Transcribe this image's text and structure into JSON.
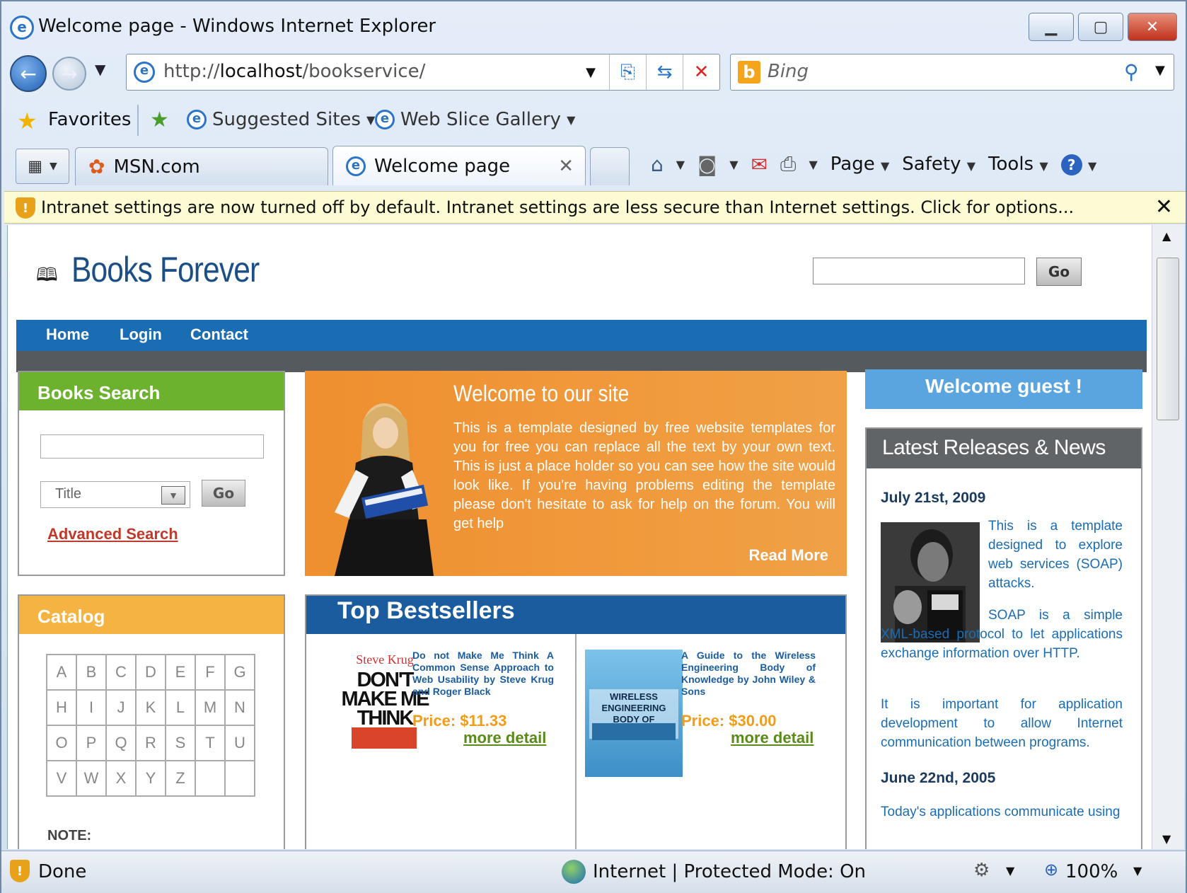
{
  "window": {
    "title": "Welcome page - Windows Internet Explorer",
    "minimize_icon": "minimize-icon",
    "maximize_icon": "maximize-icon",
    "close_icon": "close-icon"
  },
  "addressbar": {
    "url_prefix": "http://",
    "url_host": "localhost",
    "url_path": "/bookservice/"
  },
  "searchbar": {
    "placeholder": "Bing"
  },
  "favorites": {
    "label": "Favorites",
    "links": [
      "Suggested Sites",
      "Web Slice Gallery"
    ]
  },
  "tabs": [
    {
      "label": "MSN.com"
    },
    {
      "label": "Welcome page",
      "active": true
    }
  ],
  "commandbar": {
    "page": "Page",
    "safety": "Safety",
    "tools": "Tools"
  },
  "infobar": {
    "text": "Intranet settings are now turned off by default. Intranet settings are less secure than Internet settings. Click for options..."
  },
  "site": {
    "title": "Books Forever",
    "search_go": "Go",
    "nav": [
      "Home",
      "Login",
      "Contact"
    ]
  },
  "books_search": {
    "heading": "Books Search",
    "select_value": "Title",
    "go": "Go",
    "advanced": "Advanced Search"
  },
  "catalog": {
    "heading": "Catalog",
    "rows": [
      [
        "A",
        "B",
        "C",
        "D",
        "E",
        "F",
        "G"
      ],
      [
        "H",
        "I",
        "J",
        "K",
        "L",
        "M",
        "N"
      ],
      [
        "O",
        "P",
        "Q",
        "R",
        "S",
        "T",
        "U"
      ],
      [
        "V",
        "W",
        "X",
        "Y",
        "Z",
        "",
        ""
      ]
    ],
    "note": "NOTE:"
  },
  "welcome": {
    "title": "Welcome to our site",
    "text": "This is a template designed by free website templates for you for free you can replace all the text by your own text. This is just a place holder so you can see how the site would look like. If you're having problems editing the template please don't hesitate to ask for help on the forum. You will get help",
    "read_more": "Read More"
  },
  "bestsellers": {
    "title": "Top Bestsellers",
    "books": [
      {
        "cover_author": "Steve Krug",
        "cover_title": "DON'T MAKE ME THINK",
        "description": "Do not Make Me Think A Common Sense Approach to Web Usability by Steve Krug and Roger Black",
        "price": "Price: $11.33",
        "more": "more detail"
      },
      {
        "cover_title": "WIRELESS ENGINEERING BODY OF KNOWLEDGE",
        "description": "A Guide to the Wireless Engineering Body of Knowledge by John Wiley & Sons",
        "price": "Price: $30.00",
        "more": "more detail"
      }
    ]
  },
  "sidebar": {
    "welcome_guest": "Welcome guest !",
    "news_heading": "Latest Releases & News",
    "news": [
      {
        "date": "July 21st, 2009",
        "p1": "This is a template designed to explore web services (SOAP) attacks.",
        "p2": "SOAP is a simple XML-based protocol to let applications exchange information over HTTP.",
        "p3": "It is important for application development to allow Internet communication between programs."
      },
      {
        "date": "June 22nd, 2005",
        "p1": "Today's applications communicate using"
      }
    ]
  },
  "status": {
    "text": "Done",
    "zone": "Internet | Protected Mode: On",
    "zoom": "100%"
  }
}
